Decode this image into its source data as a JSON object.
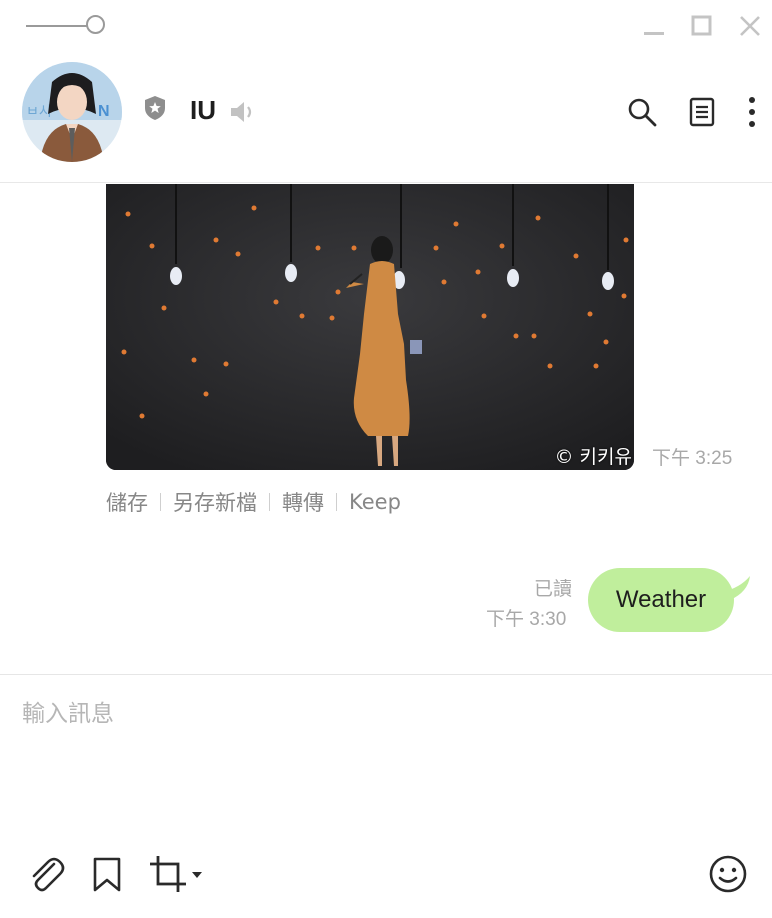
{
  "window": {
    "controls": [
      "minimize-icon",
      "maximize-icon",
      "close-icon"
    ]
  },
  "header": {
    "chat_name": "IU",
    "icons": [
      "shield-star-icon",
      "speaker-muted-icon",
      "search-icon",
      "notes-icon",
      "more-vertical-icon"
    ]
  },
  "messages": {
    "photo": {
      "credit": "© 키키유",
      "time": "下午 3:25"
    },
    "photo_actions": [
      "儲存",
      "另存新檔",
      "轉傳",
      "Keep"
    ],
    "sent": {
      "text": "Weather",
      "read_status": "已讀",
      "time": "下午 3:30"
    }
  },
  "composer": {
    "placeholder": "輸入訊息",
    "tools": [
      "paperclip-icon",
      "bookmark-icon",
      "crop-icon",
      "emoji-icon"
    ]
  },
  "colors": {
    "bubble": "#c0ee9c",
    "muted_text": "#a8a8a8",
    "icon": "#2a2a2a"
  }
}
